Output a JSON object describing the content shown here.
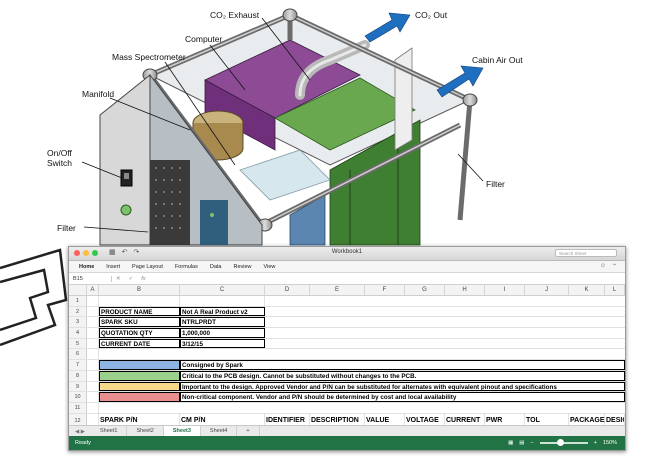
{
  "diagram": {
    "labels": {
      "co2_exhaust": "CO₂ Exhaust",
      "co2_out": "CO₂ Out",
      "computer": "Computer",
      "mass_spectrometer": "Mass Spectrometer",
      "cabin_air_out": "Cabin Air Out",
      "manifold": "Manifold",
      "on_off_1": "On/Off",
      "on_off_2": "Switch",
      "filter_right": "Filter",
      "filter_left": "Filter"
    },
    "colors": {
      "computer": "#7d3a86",
      "green": "#4a8a3a",
      "flow_arrow": "#1f6fc0"
    }
  },
  "spreadsheet": {
    "window_title": "Workbook1",
    "search_placeholder": "Search Sheet",
    "ribbon_tabs": [
      "Home",
      "Insert",
      "Page Layout",
      "Formulas",
      "Data",
      "Review",
      "View"
    ],
    "name_box": "B15",
    "formula_fx": "fx",
    "columns": [
      "A",
      "B",
      "C",
      "D",
      "E",
      "F",
      "G",
      "H",
      "I",
      "J",
      "K",
      "L"
    ],
    "row_numbers": [
      "1",
      "2",
      "3",
      "4",
      "5",
      "6",
      "7",
      "8",
      "9",
      "10",
      "11",
      "12"
    ],
    "product_block": [
      {
        "label": "PRODUCT NAME",
        "value": "Not A Real Product v2"
      },
      {
        "label": "SPARK SKU",
        "value": "NTRLPRDT"
      },
      {
        "label": "QUOTATION QTY",
        "value": "1,000,000"
      },
      {
        "label": "CURRENT DATE",
        "value": "3/12/15"
      }
    ],
    "legend": [
      {
        "color": "#8db3e2",
        "text": "Consigned by Spark"
      },
      {
        "color": "#9bd18b",
        "text": "Critical to the PCB design. Cannot be substituted without changes to the PCB."
      },
      {
        "color": "#f7d98a",
        "text": "Important to the design. Approved Vendor and P/N can be substituted for alternates with equivalent pinout and specifications"
      },
      {
        "color": "#e98e8e",
        "text": "Non-critical component. Vendor and P/N should be determined by cost and local availability"
      }
    ],
    "header_row": [
      "SPARK P/N",
      "CM P/N",
      "IDENTIFIER",
      "DESCRIPTION",
      "VALUE",
      "VOLTAGE",
      "CURRENT",
      "PWR",
      "TOL",
      "PACKAGE",
      "DESIGN"
    ],
    "sheet_tabs": [
      "Sheet1",
      "Sheet2",
      "Sheet3",
      "Sheet4"
    ],
    "active_sheet": 2,
    "add_sheet": "+",
    "status_ready": "Ready",
    "zoom": "150%"
  }
}
